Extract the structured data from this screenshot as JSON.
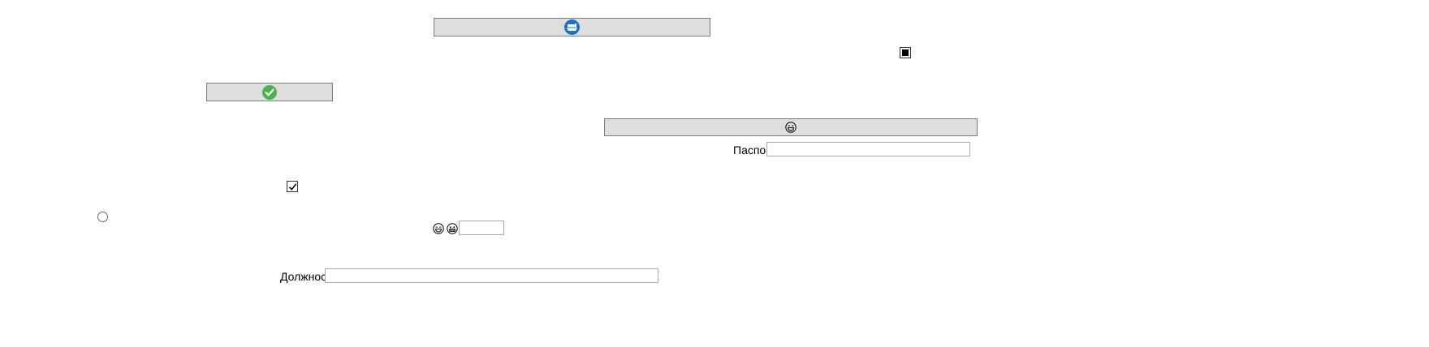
{
  "window": {
    "background": "#ffffff"
  },
  "buttons": {
    "top_button": {
      "icon": "ship-icon",
      "accent": "#1e73be"
    },
    "ok_button": {
      "icon": "check-circle-icon",
      "accent": "#4caf50"
    },
    "wide_button": {
      "icon": "laughing-face-icon"
    }
  },
  "checkboxes": {
    "stop_checkbox": {
      "state": "indeterminate-filled",
      "icon": "stop-square-icon"
    },
    "main_checkbox": {
      "checked": true,
      "icon": "check-mark-icon"
    }
  },
  "radio": {
    "checked": false
  },
  "passport": {
    "label": "Паспорт",
    "value": "",
    "placeholder": ""
  },
  "emoji_row": {
    "icons": [
      "laughing-face-icon",
      "grinning-face-icon"
    ],
    "input_value": ""
  },
  "position_field": {
    "label": "Должность",
    "value": "",
    "placeholder": ""
  }
}
